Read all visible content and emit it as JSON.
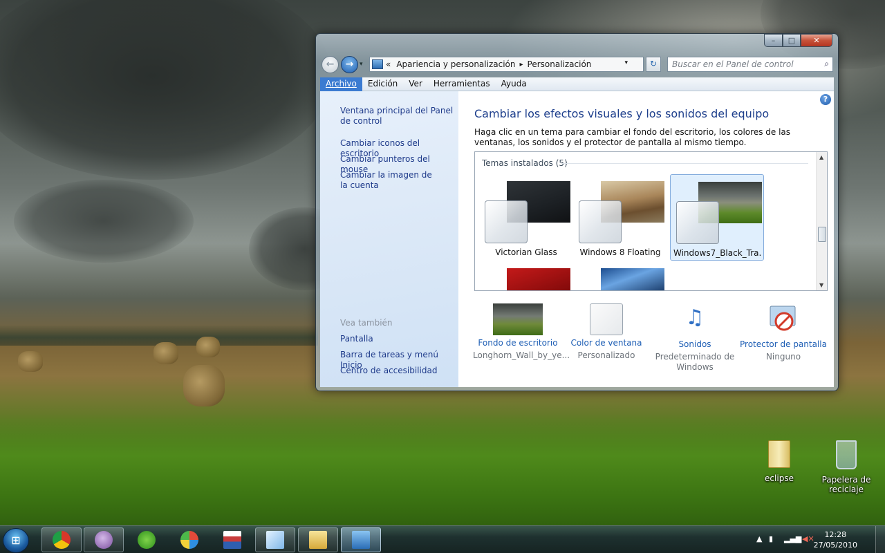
{
  "window": {
    "caption_buttons": {
      "minimize": "–",
      "maximize": "□",
      "close": "✕"
    },
    "address": {
      "recent": "▾",
      "prefix": "«",
      "crumbs": [
        "Apariencia y personalización",
        "Personalización"
      ],
      "separator": "▸",
      "dropdown": "▾",
      "refresh": "↻"
    },
    "search": {
      "placeholder": "Buscar en el Panel de control",
      "icon": "search-icon"
    },
    "menu": [
      "Archivo",
      "Edición",
      "Ver",
      "Herramientas",
      "Ayuda"
    ],
    "left_pane": {
      "links": [
        "Ventana principal del Panel de control",
        "Cambiar iconos del escritorio",
        "Cambiar punteros del mouse",
        "Cambiar la imagen de la cuenta"
      ],
      "see_also_heading": "Vea también",
      "see_also": [
        "Pantalla",
        "Barra de tareas y menú Inicio",
        "Centro de accesibilidad"
      ]
    },
    "help": "?",
    "title": "Cambiar los efectos visuales y los sonidos del equipo",
    "description": "Haga clic en un tema para cambiar el fondo del escritorio, los colores de las ventanas, los sonidos y el protector de pantalla al mismo tiempo.",
    "themes": {
      "heading": "Temas instalados (5)",
      "items": [
        {
          "name": "Victorian Glass",
          "selected": false
        },
        {
          "name": "Windows 8 Floating",
          "selected": false
        },
        {
          "name": "Windows7_Black_Tra...",
          "selected": true
        }
      ]
    },
    "options": [
      {
        "label": "Fondo de escritorio",
        "value": "Longhorn_Wall_by_ye..."
      },
      {
        "label": "Color de ventana",
        "value": "Personalizado"
      },
      {
        "label": "Sonidos",
        "value": "Predeterminado de Windows"
      },
      {
        "label": "Protector de pantalla",
        "value": "Ninguno"
      }
    ]
  },
  "desktop_icons": [
    {
      "label": "eclipse",
      "icon": "folder-icon"
    },
    {
      "label": "Papelera de reciclaje",
      "icon": "recycle-bin-icon"
    }
  ],
  "taskbar": {
    "start_glyph": "⊞",
    "items": [
      "chrome-icon",
      "pidgin-icon",
      "spotify-icon",
      "paint-icon",
      "window-app-icon",
      "notepad-icon",
      "explorer-icon",
      "control-panel-icon"
    ],
    "tray": {
      "arrow": "▲",
      "time": "12:28",
      "date": "27/05/2010"
    }
  },
  "colors": {
    "link": "#1e3a8a",
    "title": "#1e3f8c",
    "menu_active": "#3b7bd1",
    "close": "#c6523a"
  }
}
